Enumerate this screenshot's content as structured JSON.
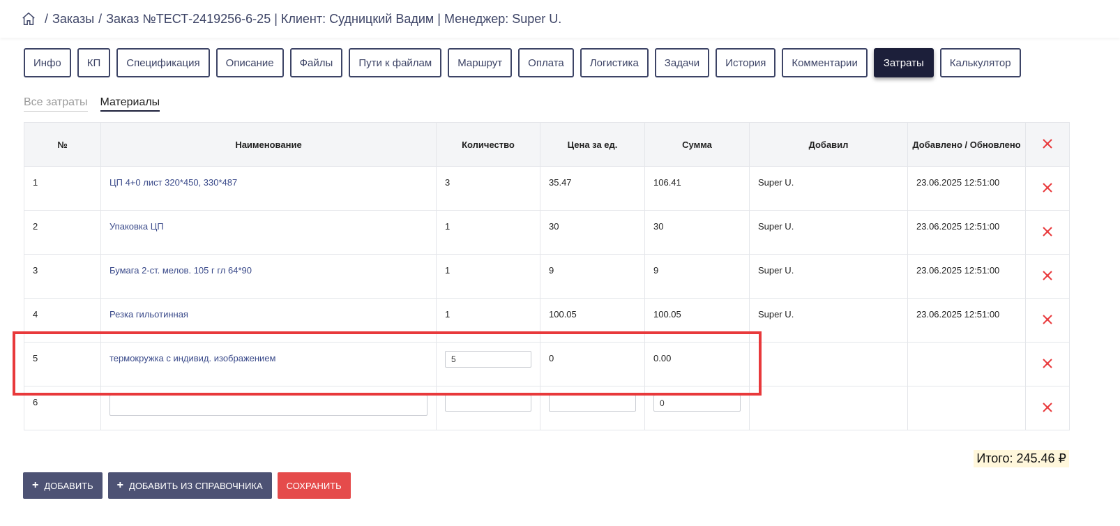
{
  "breadcrumb": {
    "separator": "/",
    "orders": "Заказы",
    "order": "Заказ №ТЕСТ-2419256-6-25 | Клиент: Судницкий Вадим | Менеджер: Super U."
  },
  "tabs": [
    {
      "label": "Инфо"
    },
    {
      "label": "КП"
    },
    {
      "label": "Спецификация"
    },
    {
      "label": "Описание"
    },
    {
      "label": "Файлы"
    },
    {
      "label": "Пути к файлам"
    },
    {
      "label": "Маршрут"
    },
    {
      "label": "Оплата"
    },
    {
      "label": "Логистика"
    },
    {
      "label": "Задачи"
    },
    {
      "label": "История"
    },
    {
      "label": "Комментарии"
    },
    {
      "label": "Затраты",
      "active": true
    },
    {
      "label": "Калькулятор"
    }
  ],
  "subtabs": [
    {
      "label": "Все затраты"
    },
    {
      "label": "Материалы",
      "active": true
    }
  ],
  "table": {
    "headers": [
      "№",
      "Наименование",
      "Количество",
      "Цена за ед.",
      "Сумма",
      "Добавил",
      "Добавлено / Обновлено"
    ],
    "rows": [
      {
        "n": "1",
        "name": "ЦП 4+0 лист 320*450, 330*487",
        "qty": "3",
        "price": "35.47",
        "sum": "106.41",
        "added_by": "Super U.",
        "date": "23.06.2025 12:51:00"
      },
      {
        "n": "2",
        "name": "Упаковка ЦП",
        "qty": "1",
        "price": "30",
        "sum": "30",
        "added_by": "Super U.",
        "date": "23.06.2025 12:51:00"
      },
      {
        "n": "3",
        "name": "Бумага 2-ст. мелов. 105 г гл 64*90",
        "qty": "1",
        "price": "9",
        "sum": "9",
        "added_by": "Super U.",
        "date": "23.06.2025 12:51:00"
      },
      {
        "n": "4",
        "name": "Резка гильотинная",
        "qty": "1",
        "price": "100.05",
        "sum": "100.05",
        "added_by": "Super U.",
        "date": "23.06.2025 12:51:00"
      },
      {
        "n": "5",
        "name": "термокружка с индивид. изображением",
        "qty_input": "5",
        "price": "0",
        "sum": "0.00",
        "added_by": "",
        "date": ""
      },
      {
        "n": "6",
        "name_input": "",
        "qty_input": "",
        "price_input": "",
        "sum_input": "0",
        "added_by": "",
        "date": ""
      }
    ]
  },
  "total": "Итого: 245.46 ₽",
  "buttons": {
    "add": "Добавить",
    "add_from_directory": "Добавить из справочника",
    "save": "Сохранить"
  },
  "colors": {
    "accent_dark": "#1c1f3a",
    "tab_border": "#3d4466",
    "delete_red": "#e8393b",
    "highlight_red": "#e8393b",
    "save_button": "#e54b4b",
    "button_dark": "#4d5274",
    "total_bg": "#fff7db"
  }
}
